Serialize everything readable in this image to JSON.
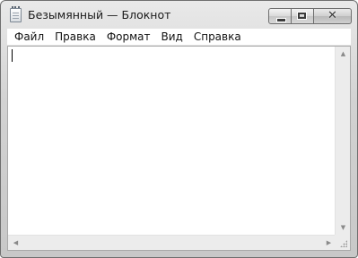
{
  "window": {
    "title": "Безымянный — Блокнот"
  },
  "caption_buttons": {
    "minimize_icon": "minimize-icon",
    "maximize_icon": "maximize-icon",
    "close_icon": "close-icon",
    "close_glyph": "✕"
  },
  "menu": {
    "items": [
      {
        "label": "Файл"
      },
      {
        "label": "Правка"
      },
      {
        "label": "Формат"
      },
      {
        "label": "Вид"
      },
      {
        "label": "Справка"
      }
    ]
  },
  "editor": {
    "content": ""
  },
  "scrollbars": {
    "up_arrow": "▲",
    "down_arrow": "▼",
    "left_arrow": "◀",
    "right_arrow": "▶"
  }
}
